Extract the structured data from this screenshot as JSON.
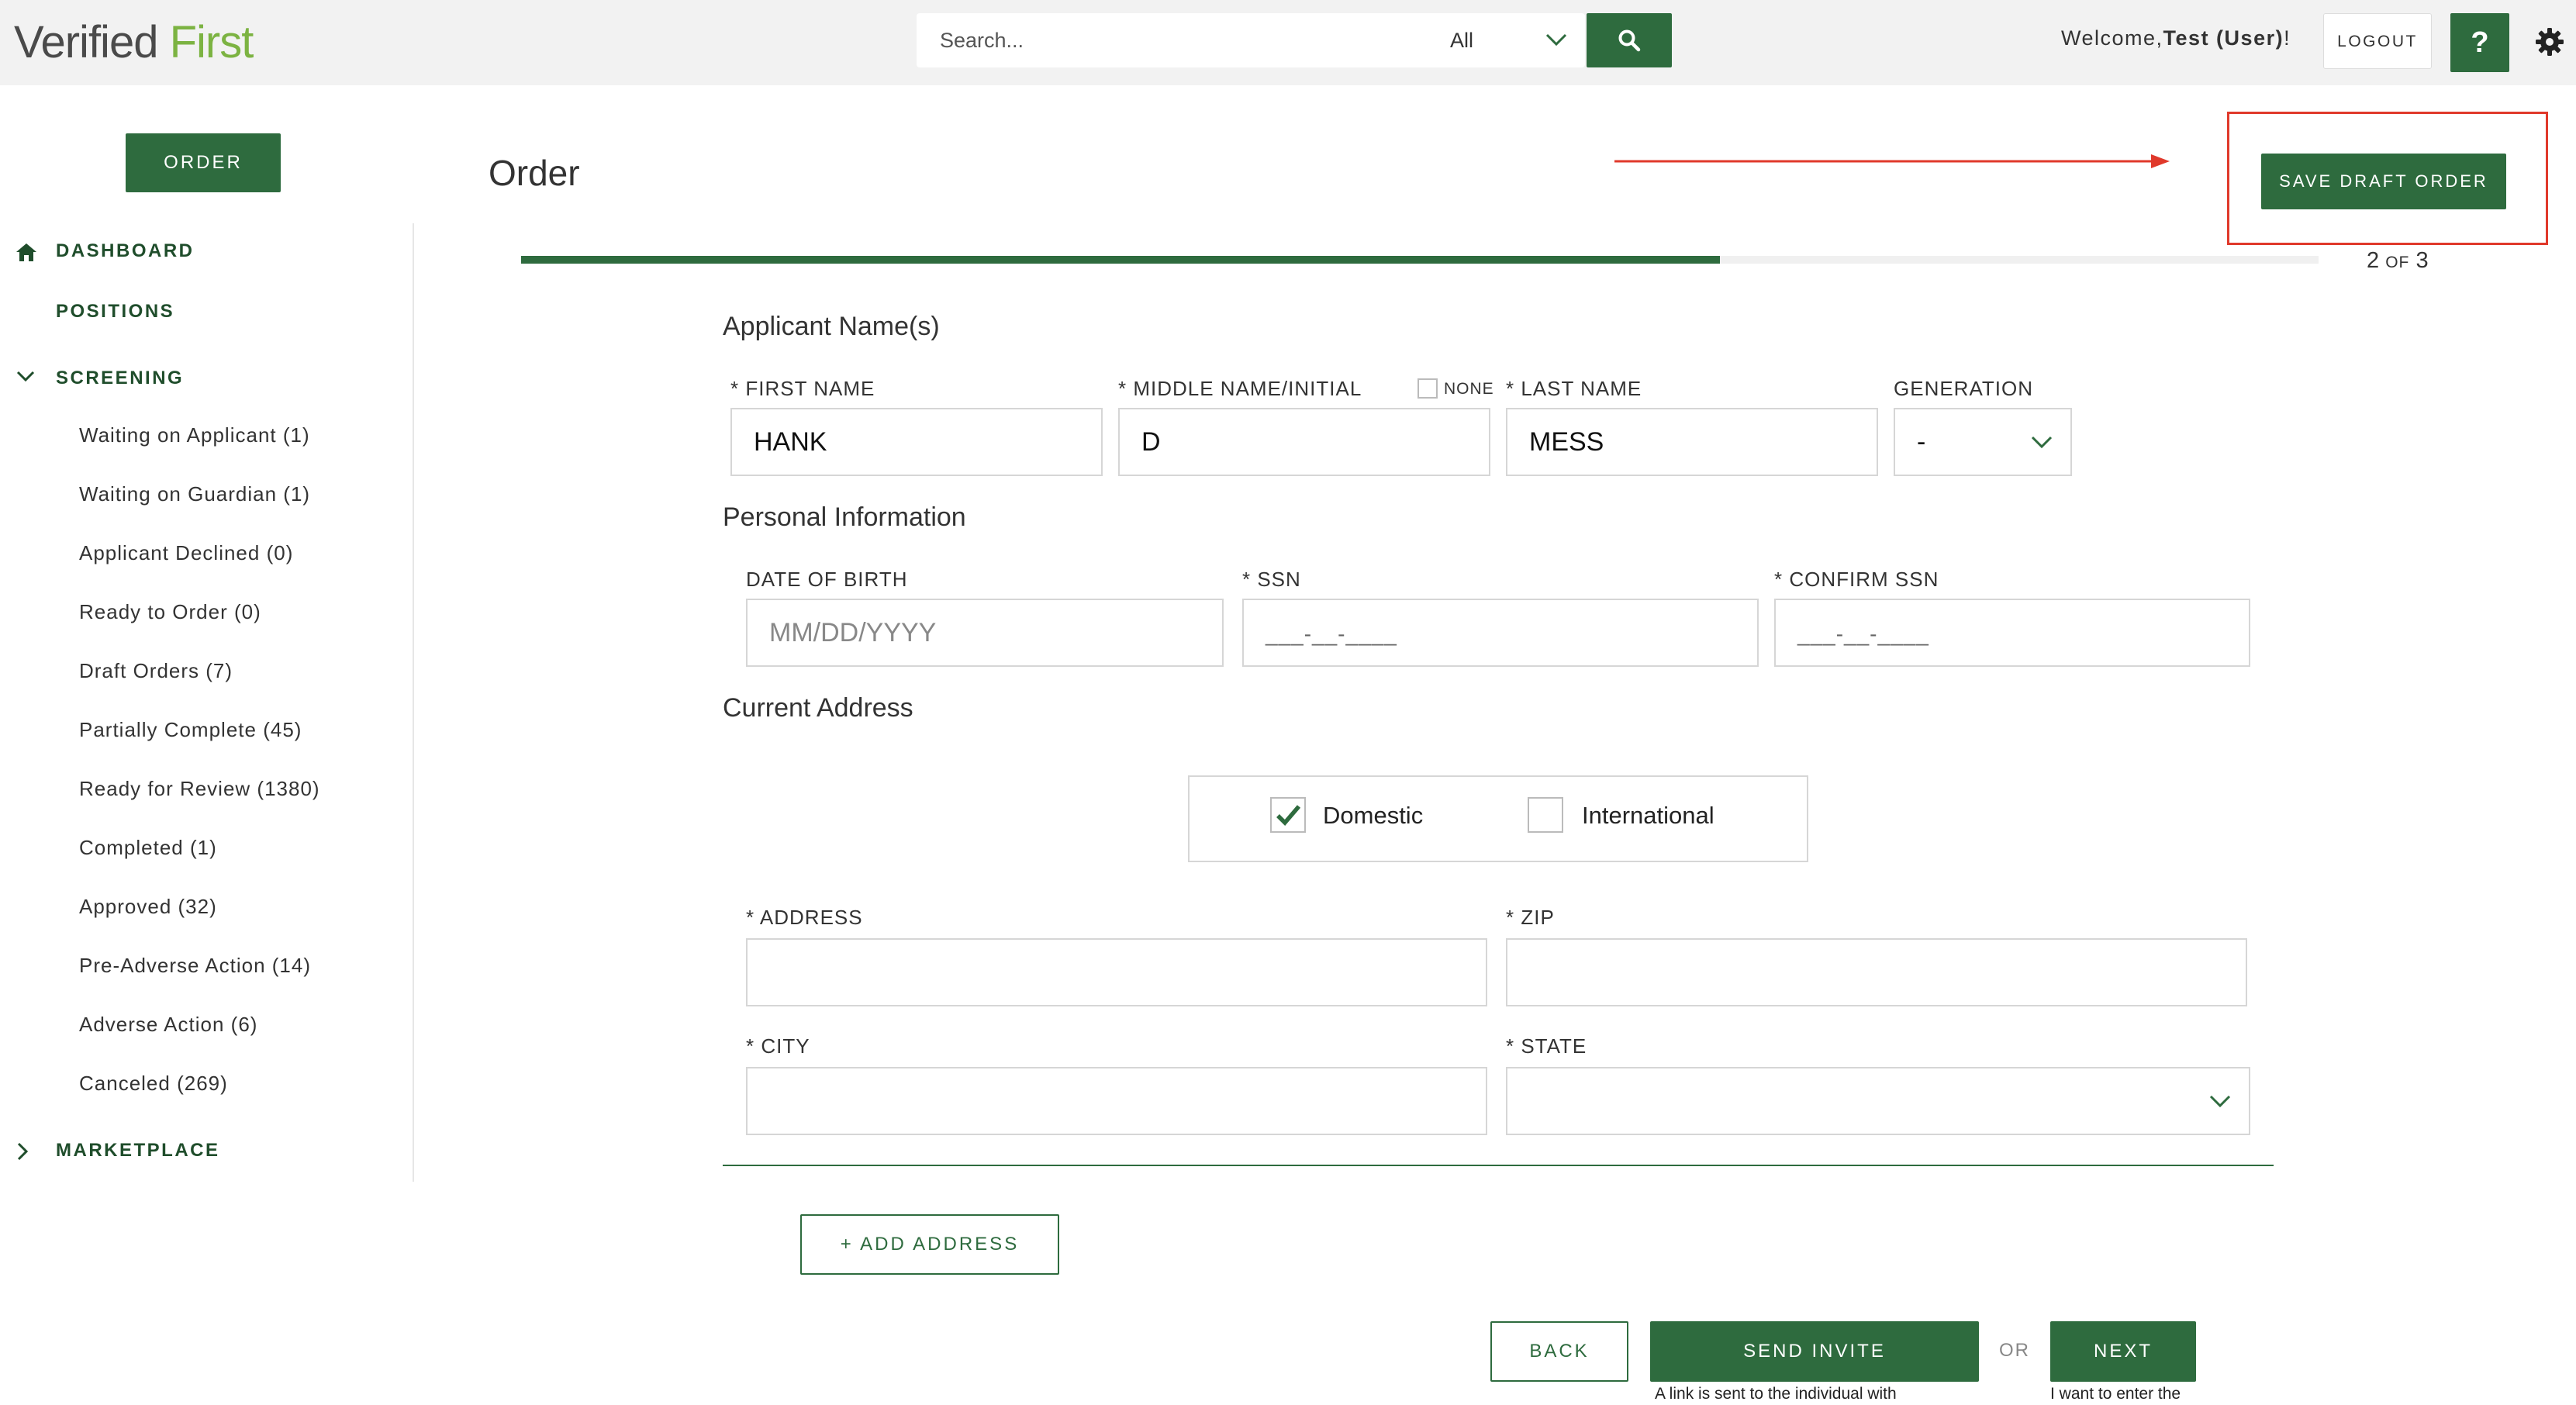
{
  "header": {
    "logo_part1": "Verified",
    "logo_part2": "First",
    "search_placeholder": "Search...",
    "search_scope": "All",
    "welcome_prefix": "Welcome,",
    "welcome_user": "Test (User)",
    "welcome_suffix": "!",
    "logout_label": "LOGOUT",
    "help_label": "?"
  },
  "sidebar": {
    "order_button": "ORDER",
    "dashboard": "DASHBOARD",
    "positions": "POSITIONS",
    "screening": "SCREENING",
    "screening_items": [
      "Waiting on Applicant (1)",
      "Waiting on Guardian (1)",
      "Applicant Declined (0)",
      "Ready to Order (0)",
      "Draft Orders (7)",
      "Partially Complete (45)",
      "Ready for Review (1380)",
      "Completed (1)",
      "Approved (32)",
      "Pre-Adverse Action (14)",
      "Adverse Action (6)",
      "Canceled (269)"
    ],
    "marketplace": "MARKETPLACE"
  },
  "main": {
    "title": "Order",
    "save_draft": "SAVE DRAFT ORDER",
    "progress": {
      "current": 2,
      "total": 3,
      "current_text": "2",
      "of_text": "OF",
      "total_text": "3",
      "fraction": 0.667
    },
    "applicant_section": "Applicant Name(s)",
    "first_name_label": "* FIRST NAME",
    "first_name_value": "HANK",
    "middle_name_label": "* MIDDLE NAME/INITIAL",
    "none_label": "NONE",
    "middle_name_value": "D",
    "last_name_label": "* LAST NAME",
    "last_name_value": "MESS",
    "generation_label": "GENERATION",
    "generation_value": "-",
    "personal_section": "Personal Information",
    "dob_label": "DATE OF BIRTH",
    "dob_placeholder": "MM/DD/YYYY",
    "ssn_label": "* SSN",
    "ssn_mask": "___-__-____",
    "confirm_ssn_label": "* CONFIRM SSN",
    "confirm_ssn_mask": "___-__-____",
    "address_section": "Current Address",
    "domestic_label": "Domestic",
    "domestic_checked": true,
    "international_label": "International",
    "international_checked": false,
    "address_label": "* ADDRESS",
    "zip_label": "* ZIP",
    "city_label": "* CITY",
    "state_label": "* STATE",
    "add_address": "+ ADD ADDRESS",
    "back": "BACK",
    "send_invite": "SEND INVITE",
    "or": "OR",
    "next": "NEXT",
    "send_invite_hint": "A link is sent to the individual with",
    "next_hint": "I want to enter the"
  },
  "colors": {
    "brand_green": "#2e6b3e",
    "logo_green": "#7cb342",
    "highlight_red": "#e0392b"
  },
  "icons": [
    "search-icon",
    "chevron-down-icon",
    "gear-icon",
    "home-icon",
    "chevron-right-icon",
    "checkmark-icon",
    "arrow-right-icon"
  ]
}
